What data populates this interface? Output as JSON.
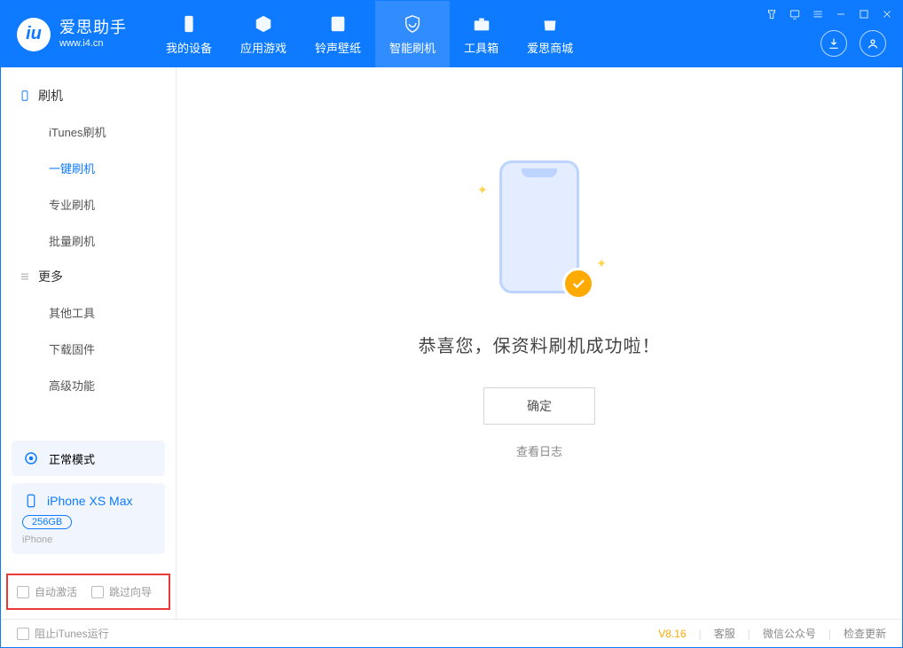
{
  "app": {
    "title": "爱思助手",
    "subtitle": "www.i4.cn"
  },
  "nav": {
    "items": [
      {
        "label": "我的设备"
      },
      {
        "label": "应用游戏"
      },
      {
        "label": "铃声壁纸"
      },
      {
        "label": "智能刷机"
      },
      {
        "label": "工具箱"
      },
      {
        "label": "爱思商城"
      }
    ]
  },
  "sidebar": {
    "flash": {
      "title": "刷机",
      "items": [
        {
          "label": "iTunes刷机"
        },
        {
          "label": "一键刷机"
        },
        {
          "label": "专业刷机"
        },
        {
          "label": "批量刷机"
        }
      ]
    },
    "more": {
      "title": "更多",
      "items": [
        {
          "label": "其他工具"
        },
        {
          "label": "下载固件"
        },
        {
          "label": "高级功能"
        }
      ]
    },
    "mode_label": "正常模式",
    "device": {
      "name": "iPhone XS Max",
      "storage": "256GB",
      "type": "iPhone"
    },
    "opts": {
      "auto_activate": "自动激活",
      "skip_guide": "跳过向导"
    }
  },
  "main": {
    "success_text": "恭喜您，保资料刷机成功啦！",
    "ok_label": "确定",
    "log_label": "查看日志"
  },
  "footer": {
    "block_itunes": "阻止iTunes运行",
    "version": "V8.16",
    "support": "客服",
    "wechat": "微信公众号",
    "update": "检查更新"
  }
}
